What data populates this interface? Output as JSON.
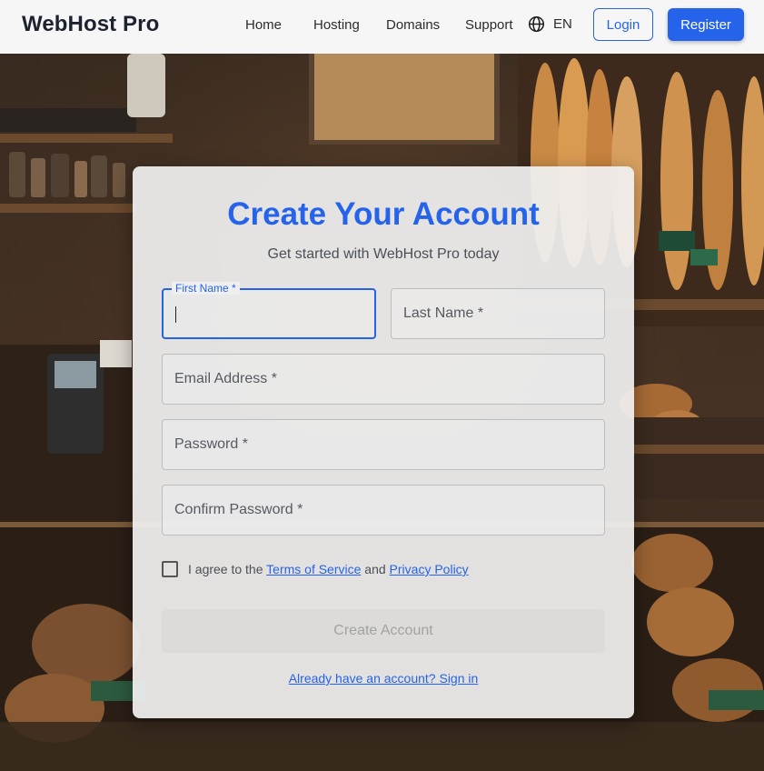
{
  "header": {
    "brand": "WebHost Pro",
    "nav": [
      "Home",
      "Hosting",
      "Domains",
      "Support"
    ],
    "language": "EN",
    "language_icon": "globe-icon",
    "login_label": "Login",
    "register_label": "Register"
  },
  "form": {
    "title": "Create Your Account",
    "subtitle": "Get started with WebHost Pro today",
    "first_name_label": "First Name *",
    "first_name_value": "",
    "last_name_placeholder": "Last Name *",
    "email_placeholder": "Email Address *",
    "password_placeholder": "Password *",
    "confirm_password_placeholder": "Confirm Password *",
    "agree_prefix": "I agree to the",
    "terms_label": "Terms of Service",
    "agree_and": "and",
    "privacy_label": "Privacy Policy",
    "agree_checked": false,
    "submit_label": "Create Account",
    "submit_disabled": true,
    "signin_label": "Already have an account? Sign in"
  },
  "colors": {
    "accent": "#2563eb",
    "header_bg": "#f6f6f6",
    "card_bg": "#f0f0f0"
  }
}
